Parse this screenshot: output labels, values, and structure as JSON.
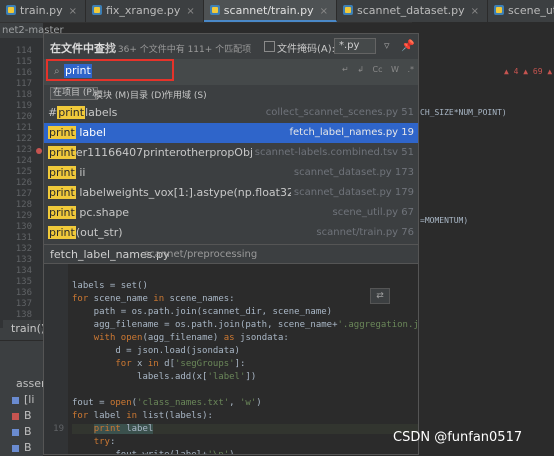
{
  "tabs": [
    {
      "label": "train.py",
      "active": false
    },
    {
      "label": "fix_xrange.py",
      "active": false
    },
    {
      "label": "scannet/train.py",
      "active": true
    },
    {
      "label": "scannet_dataset.py",
      "active": false
    },
    {
      "label": "scene_util.py",
      "active": false
    },
    {
      "label": "provider.py",
      "active": false
    },
    {
      "label": "tf_",
      "active": false
    }
  ],
  "project_label": "net2-master",
  "gutter_lines": [
    "114",
    "115",
    "116",
    "117",
    "118",
    "119",
    "120",
    "121",
    "122",
    "123",
    "124",
    "125",
    "126",
    "127",
    "128",
    "129",
    "130",
    "131",
    "132",
    "133",
    "134",
    "135",
    "136",
    "137",
    "138"
  ],
  "run_tab": "train()",
  "run_lines": [
    "assert",
    "[li",
    "B",
    "B",
    "B"
  ],
  "find_popup": {
    "title": "在文件中查找",
    "summary": "在 36+ 个文件中有 111+ 个匹配项",
    "file_mask_label": "文件掩码(A):",
    "file_mask_value": "*.py",
    "query": "print",
    "options": [
      "↵",
      "↲",
      "Cc",
      "W",
      ".*"
    ],
    "scopes": [
      {
        "label": "在项目 (P)",
        "selected": true
      },
      {
        "label": "模块 (M)",
        "selected": false
      },
      {
        "label": "目录 (D)",
        "selected": false
      },
      {
        "label": "作用域 (S)",
        "selected": false
      }
    ],
    "results": [
      {
        "prefix": "#",
        "match": "print",
        "rest": "labels",
        "file": "collect_scannet_scenes.py 51",
        "selected": false
      },
      {
        "prefix": "",
        "match": "print",
        "rest": " label",
        "file": "fetch_label_names.py 19",
        "selected": true
      },
      {
        "prefix": "",
        "match": "print",
        "rest": "er11166407printerotherpropObjectsprinter0400447",
        "file": "scannet-labels.combined.tsv 51",
        "selected": false
      },
      {
        "prefix": "",
        "match": "print",
        "rest": " ii",
        "file": "scannet_dataset.py 173",
        "selected": false
      },
      {
        "prefix": "",
        "match": "print",
        "rest": " labelweights_vox[1:].astype(np.float32)/np.sum(labelweigh",
        "file": "scannet_dataset.py 179",
        "selected": false
      },
      {
        "prefix": "",
        "match": "print",
        "rest": " pc.shape",
        "file": "scene_util.py 67",
        "selected": false
      },
      {
        "prefix": "",
        "match": "print",
        "rest": "(out_str)",
        "file": "scannet/train.py 76",
        "selected": false
      }
    ],
    "preview_file": "fetch_label_names.py",
    "preview_dir": "scannet/preprocessing",
    "preview_lines": [
      {
        "n": "",
        "t": ""
      },
      {
        "n": "",
        "t": "labels = set()"
      },
      {
        "n": "",
        "t": "for scene_name in scene_names:"
      },
      {
        "n": "",
        "t": "    path = os.path.join(scannet_dir, scene_name)"
      },
      {
        "n": "",
        "t": "    agg_filename = os.path.join(path, scene_name+'.aggregation.json')"
      },
      {
        "n": "",
        "t": "    with open(agg_filename) as jsondata:"
      },
      {
        "n": "",
        "t": "        d = json.load(jsondata)"
      },
      {
        "n": "",
        "t": "        for x in d['segGroups']:"
      },
      {
        "n": "",
        "t": "            labels.add(x['label'])"
      },
      {
        "n": "",
        "t": ""
      },
      {
        "n": "",
        "t": "fout = open('class_names.txt', 'w')"
      },
      {
        "n": "",
        "t": "for label in list(labels):"
      },
      {
        "n": "19",
        "t": "    print label"
      },
      {
        "n": "",
        "t": "    try:"
      },
      {
        "n": "",
        "t": "        fout.write(label+'\\n')"
      }
    ]
  },
  "right_code": [
    "▲ 4   ▲ 69   ▲ 9",
    "CH_SIZE*NUM_POINT)",
    "=MOMENTUM)"
  ],
  "watermark": "CSDN @funfan0517",
  "colors": {
    "accent": "#2f65ca",
    "highlight": "#f0c93a",
    "search_outline": "#e5332a"
  }
}
